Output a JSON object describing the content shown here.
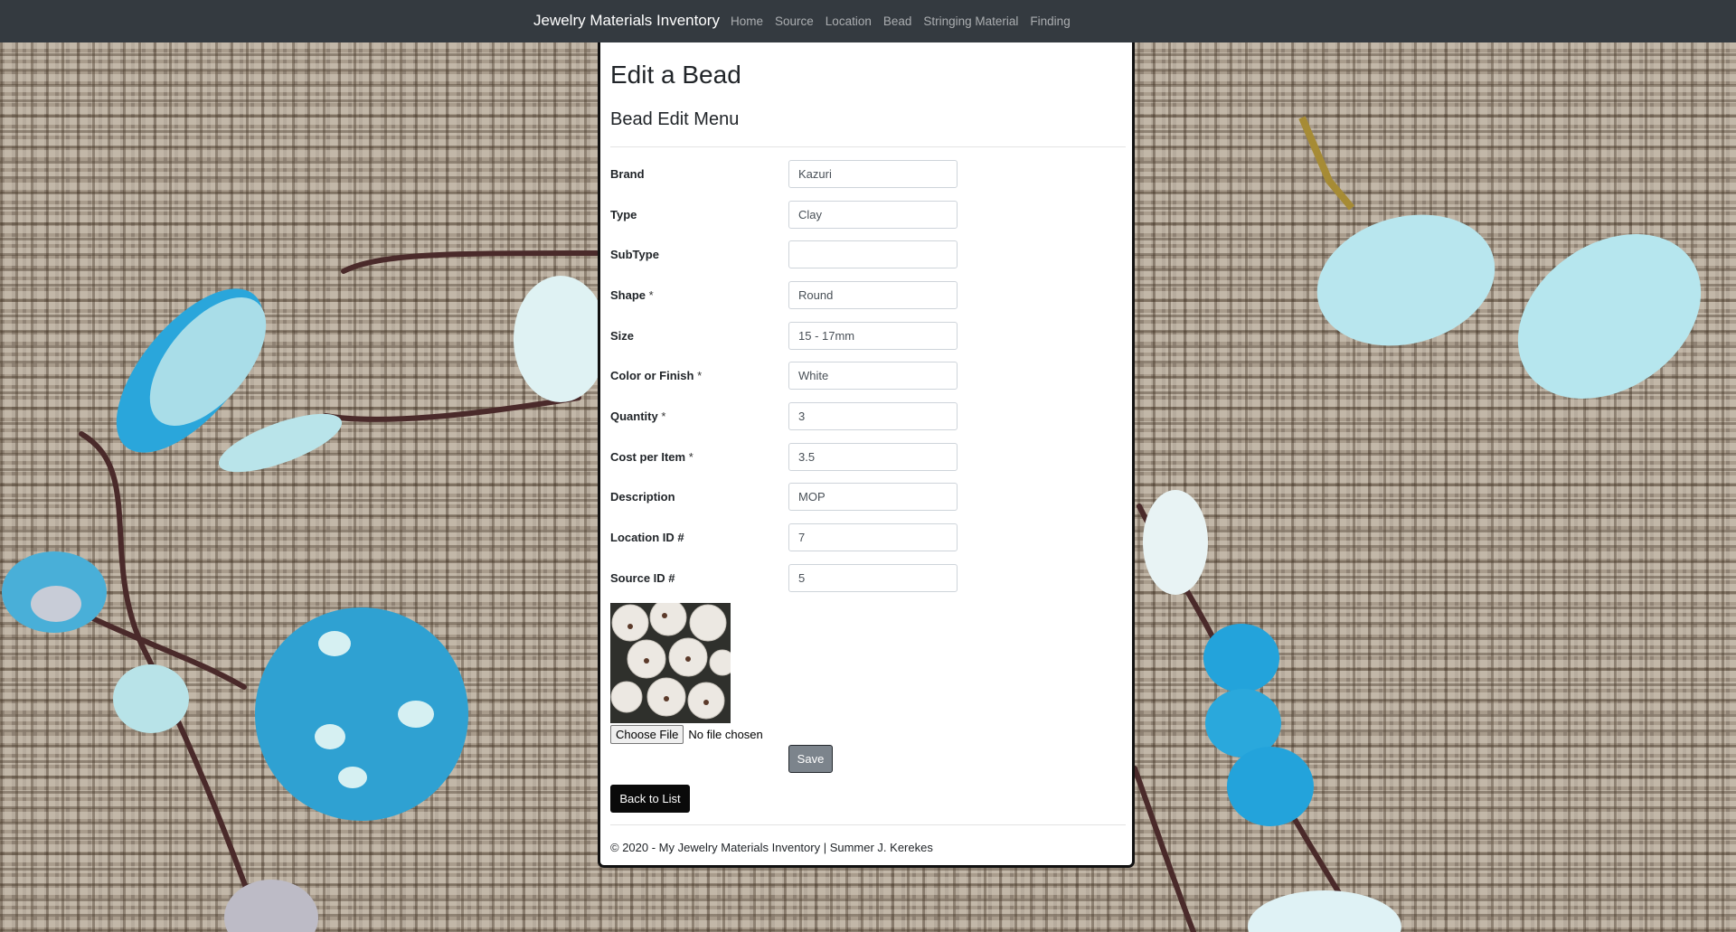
{
  "navbar": {
    "brand": "Jewelry Materials Inventory",
    "links": [
      "Home",
      "Source",
      "Location",
      "Bead",
      "Stringing Material",
      "Finding"
    ]
  },
  "page": {
    "title": "Edit a Bead",
    "subtitle": "Bead Edit Menu"
  },
  "form": {
    "fields": [
      {
        "label": "Brand",
        "required": false,
        "value": "Kazuri"
      },
      {
        "label": "Type",
        "required": false,
        "value": "Clay"
      },
      {
        "label": "SubType",
        "required": false,
        "value": ""
      },
      {
        "label": "Shape",
        "required": true,
        "value": "Round"
      },
      {
        "label": "Size",
        "required": false,
        "value": "15 - 17mm"
      },
      {
        "label": "Color or Finish",
        "required": true,
        "value": "White"
      },
      {
        "label": "Quantity",
        "required": true,
        "value": "3"
      },
      {
        "label": "Cost per Item",
        "required": true,
        "value": "3.5"
      },
      {
        "label": "Description",
        "required": false,
        "value": "MOP"
      },
      {
        "label": "Location ID #",
        "required": false,
        "value": "7"
      },
      {
        "label": "Source ID #",
        "required": false,
        "value": "5"
      }
    ],
    "required_mark": "*",
    "file": {
      "button": "Choose File",
      "status": "No file chosen"
    },
    "save": "Save"
  },
  "back": "Back to List",
  "footer": "© 2020 - My Jewelry Materials Inventory | Summer J. Kerekes",
  "colors": {
    "navbar": "#343a40",
    "save_button": "#7c848c",
    "back_button": "#0a0a0a"
  }
}
